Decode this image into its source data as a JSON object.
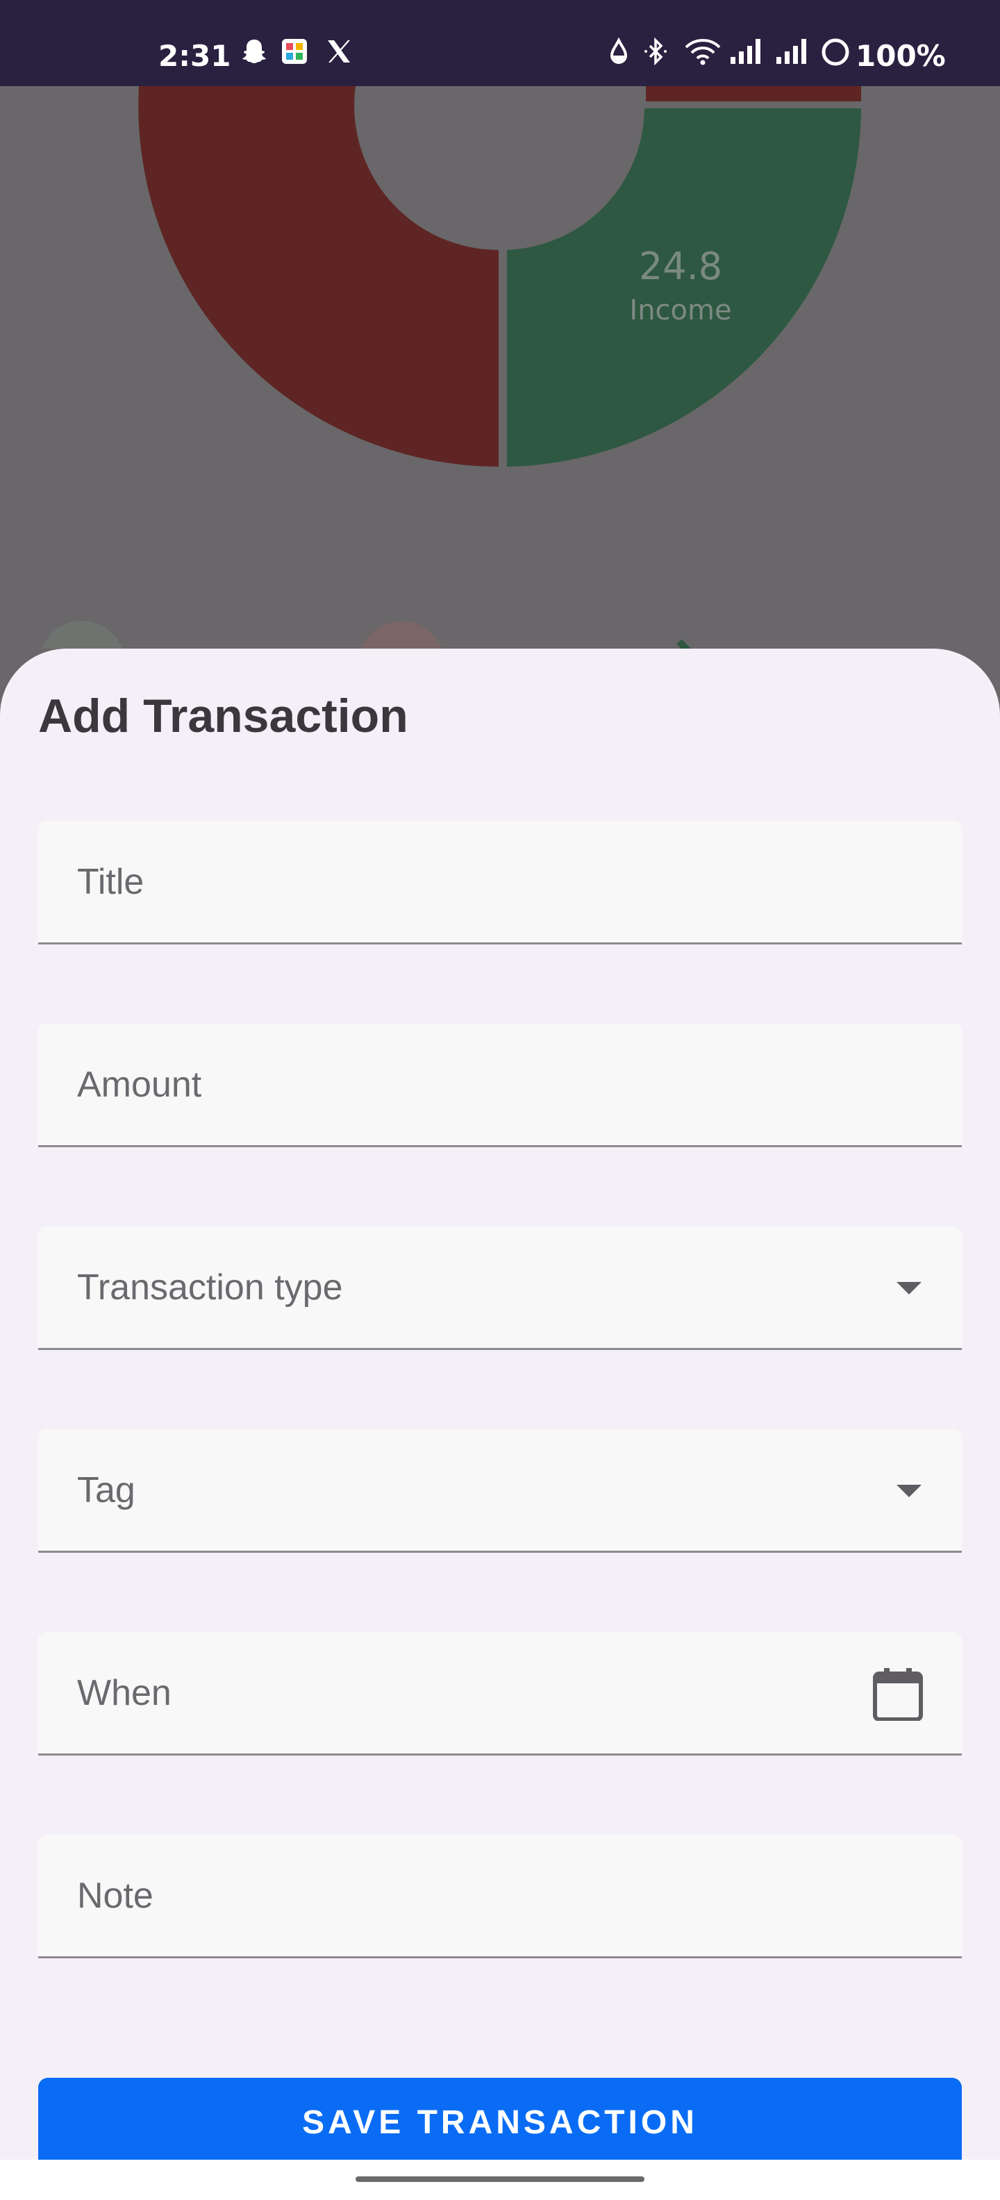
{
  "status_bar": {
    "time": "2:31",
    "battery": "100%",
    "icons": [
      "snapchat-icon",
      "app-grid-icon",
      "x-icon",
      "water-drop-icon",
      "bluetooth-icon",
      "wifi-icon",
      "signal-icon",
      "signal-icon",
      "battery-icon"
    ]
  },
  "background_chart": {
    "slice_value": "24.8",
    "slice_label": "Income",
    "colors": {
      "expense": "#5e2524",
      "income": "#2e5841",
      "dim": "#696769"
    }
  },
  "sheet": {
    "title": "Add Transaction",
    "fields": {
      "title": {
        "placeholder": "Title"
      },
      "amount": {
        "placeholder": "Amount"
      },
      "transaction_type": {
        "placeholder": "Transaction type",
        "trailing_icon": "dropdown-arrow-icon"
      },
      "tag": {
        "placeholder": "Tag",
        "trailing_icon": "dropdown-arrow-icon"
      },
      "when": {
        "placeholder": "When",
        "trailing_icon": "calendar-icon"
      },
      "note": {
        "placeholder": "Note"
      }
    },
    "save_label": "SAVE TRANSACTION",
    "accent": "#0a6cf4"
  }
}
